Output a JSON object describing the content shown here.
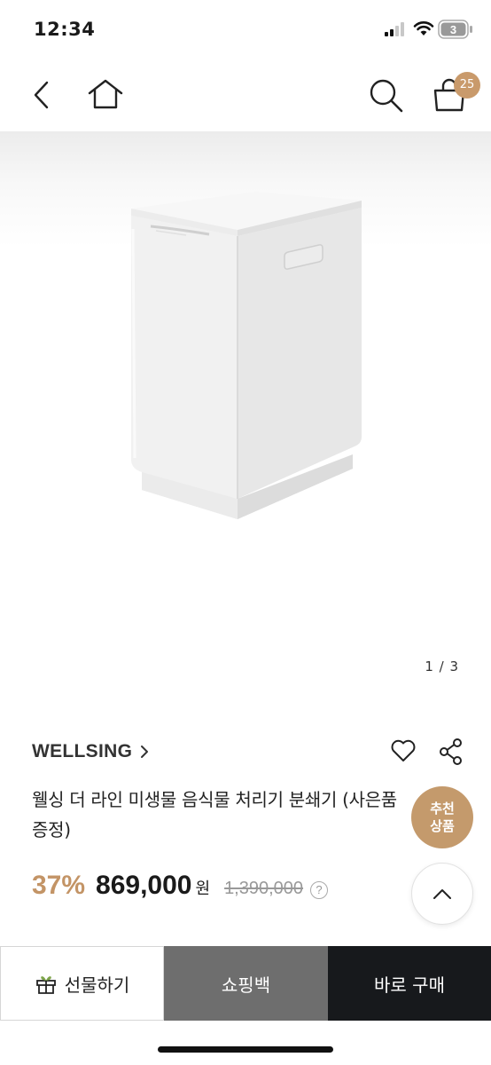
{
  "status_bar": {
    "time": "12:34",
    "battery_level": "3",
    "icons": [
      "cellular-signal-icon",
      "wifi-icon",
      "battery-icon"
    ]
  },
  "nav": {
    "icons": [
      "back-arrow-icon",
      "home-icon",
      "search-icon",
      "shopping-bag-icon"
    ],
    "cart_count": "25"
  },
  "gallery": {
    "counter": "1 / 3",
    "image": "white food waste disposer product photo"
  },
  "product": {
    "brand": "WELLSING",
    "title": "웰싱 더 라인 미생물 음식물 처리기 분쇄기 (사은품 증정)",
    "discount": "37%",
    "price": "869,000",
    "currency": "원",
    "original_price": "1,390,000",
    "help_icon": "?"
  },
  "floating": {
    "recommend_label": "추천\n상품",
    "recommend_line1": "추천",
    "recommend_line2": "상품"
  },
  "actions": {
    "gift": "선물하기",
    "cart": "쇼핑백",
    "buy": "바로 구매"
  },
  "colors": {
    "accent": "#c49a6c",
    "buy_button": "#17191c",
    "cart_button": "#6e6e6e"
  }
}
